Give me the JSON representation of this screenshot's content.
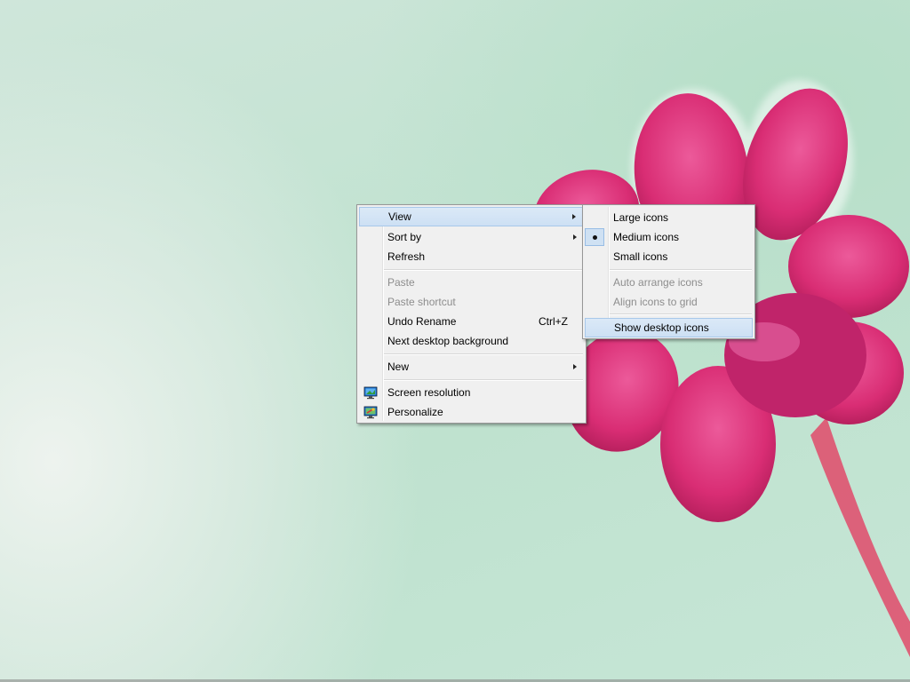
{
  "context_menu": {
    "items": [
      {
        "label": "View",
        "shortcut": "",
        "submenu": true,
        "disabled": false,
        "highlighted": true
      },
      {
        "label": "Sort by",
        "shortcut": "",
        "submenu": true,
        "disabled": false
      },
      {
        "label": "Refresh",
        "shortcut": "",
        "submenu": false,
        "disabled": false
      },
      {
        "label": "Paste",
        "shortcut": "",
        "submenu": false,
        "disabled": true
      },
      {
        "label": "Paste shortcut",
        "shortcut": "",
        "submenu": false,
        "disabled": true
      },
      {
        "label": "Undo Rename",
        "shortcut": "Ctrl+Z",
        "submenu": false,
        "disabled": false
      },
      {
        "label": "Next desktop background",
        "shortcut": "",
        "submenu": false,
        "disabled": false
      },
      {
        "label": "New",
        "shortcut": "",
        "submenu": true,
        "disabled": false
      },
      {
        "label": "Screen resolution",
        "shortcut": "",
        "icon": "display-settings-icon",
        "disabled": false
      },
      {
        "label": "Personalize",
        "shortcut": "",
        "icon": "personalize-icon",
        "disabled": false
      }
    ]
  },
  "view_submenu": {
    "items": [
      {
        "label": "Large icons",
        "checked": false,
        "disabled": false
      },
      {
        "label": "Medium icons",
        "checked": true,
        "disabled": false
      },
      {
        "label": "Small icons",
        "checked": false,
        "disabled": false
      },
      {
        "label": "Auto arrange icons",
        "checked": false,
        "disabled": true
      },
      {
        "label": "Align icons to grid",
        "checked": false,
        "disabled": true
      },
      {
        "label": "Show desktop icons",
        "checked": false,
        "disabled": false,
        "highlighted": true
      }
    ]
  },
  "colors": {
    "highlight": "#cde0f4",
    "menu_bg": "#f0f0f0",
    "petal": "#e0307a"
  }
}
